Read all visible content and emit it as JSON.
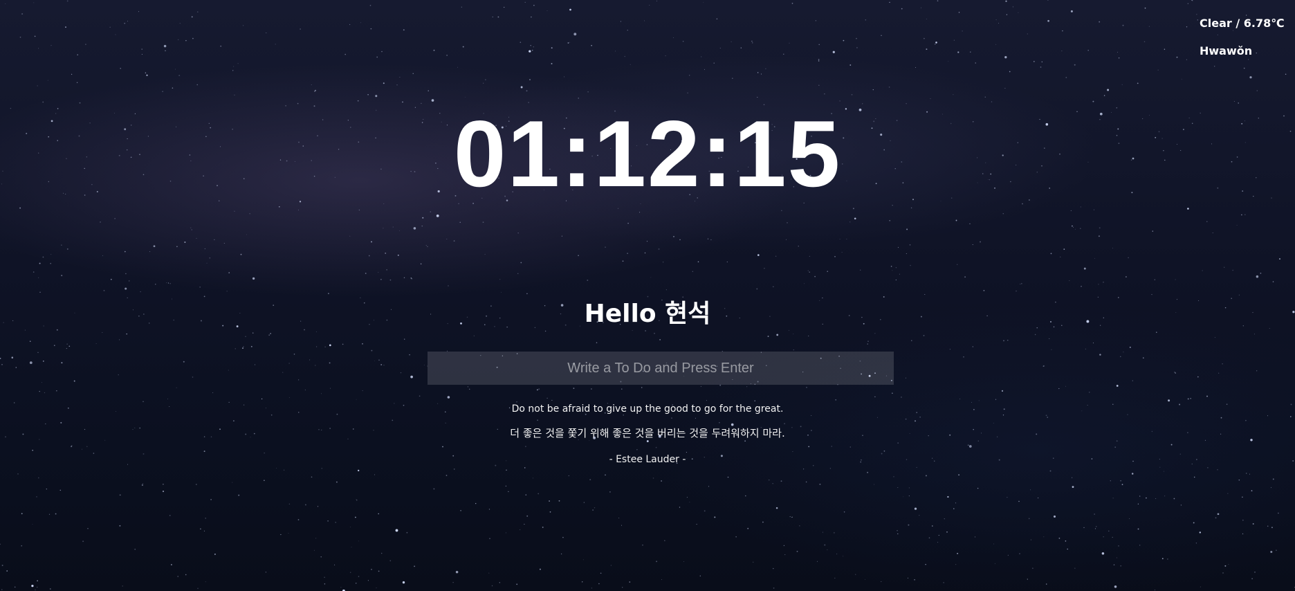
{
  "weather": {
    "condition_temp": "Clear / 6.78℃",
    "location": "Hwawŏn"
  },
  "clock": {
    "time": "01:12:15"
  },
  "greeting": {
    "text": "Hello 현석"
  },
  "todo": {
    "placeholder": "Write a To Do and Press Enter",
    "value": ""
  },
  "quote": {
    "english": "Do not be afraid to give up the good to go for the great.",
    "korean": "더 좋은 것을 쫓기 위해 좋은 것을 버리는 것을 두려워하지 마라.",
    "author": "- Estee Lauder -"
  }
}
